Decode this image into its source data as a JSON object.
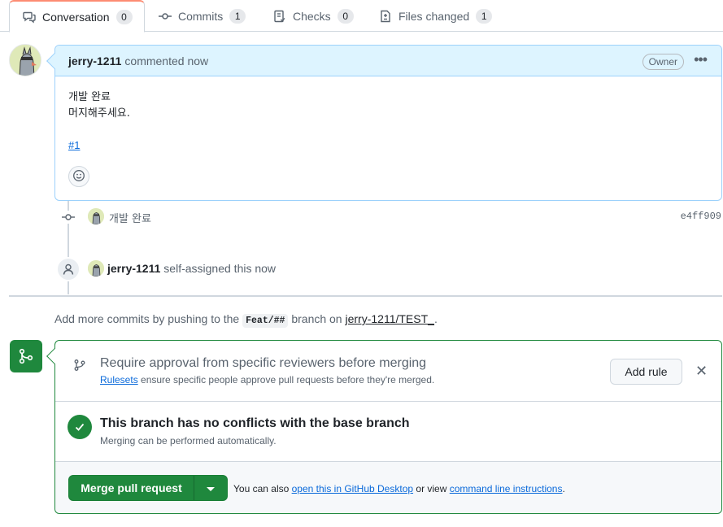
{
  "tabs": [
    {
      "label": "Conversation",
      "count": "0"
    },
    {
      "label": "Commits",
      "count": "1"
    },
    {
      "label": "Checks",
      "count": "0"
    },
    {
      "label": "Files changed",
      "count": "1"
    }
  ],
  "comment": {
    "author": "jerry-1211",
    "meta": "commented now",
    "badge": "Owner",
    "menu": "•••",
    "line1": "개발 완료",
    "line2": "머지해주세요.",
    "link": "#1"
  },
  "commit": {
    "message": "개발 완료",
    "sha": "e4ff909"
  },
  "assign": {
    "user": "jerry-1211",
    "action": "self-assigned this now"
  },
  "push_hint": {
    "prefix": "Add more commits by pushing to the",
    "branch": "Feat/##",
    "middle": "branch on",
    "repo": "jerry-1211/TEST_",
    "suffix": "."
  },
  "ruleset": {
    "title": "Require approval from specific reviewers before merging",
    "link": "Rulesets",
    "sub": "ensure specific people approve pull requests before they're merged.",
    "button": "Add rule",
    "close": "✕"
  },
  "conflicts": {
    "title": "This branch has no conflicts with the base branch",
    "sub": "Merging can be performed automatically."
  },
  "merge": {
    "button": "Merge pull request",
    "note_prefix": "You can also",
    "link1": "open this in GitHub Desktop",
    "note_mid": "or view",
    "link2": "command line instructions",
    "note_suffix": "."
  },
  "colors": {
    "accent_green": "#1f883d",
    "link_blue": "#0969da",
    "comment_header": "#ddf4ff",
    "tab_underline": "#fd8c73"
  }
}
